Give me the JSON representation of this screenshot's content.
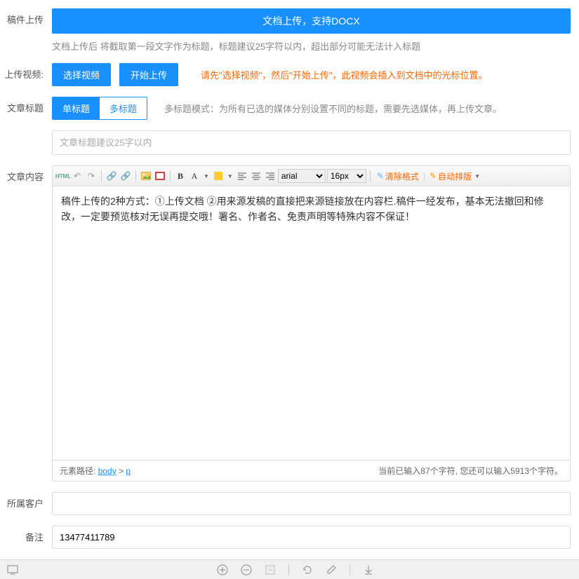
{
  "upload_doc": {
    "label": "稿件上传",
    "button": "文档上传，支持DOCX",
    "hint": "文档上传后 将截取第一段文字作为标题，标题建议25字符以内，超出部分可能无法计入标题"
  },
  "upload_video": {
    "label": "上传视频:",
    "select_btn": "选择视频",
    "start_btn": "开始上传",
    "hint": "请先\"选择视频\"，然后\"开始上传\"，此视频会插入到文档中的光标位置。"
  },
  "title": {
    "label": "文章标题",
    "tab_single": "单标题",
    "tab_multi": "多标题",
    "tab_hint": "多标题模式：为所有已选的媒体分别设置不同的标题，需要先选媒体，再上传文章。",
    "placeholder": "文章标题建议25字以内"
  },
  "content": {
    "label": "文章内容",
    "font_family": "arial",
    "font_size": "16px",
    "clear_format": "清除格式",
    "auto_typeset": "自动排版",
    "body_text": "稿件上传的2种方式：①上传文档 ②用来源发稿的直接把来源链接放在内容栏.稿件一经发布，基本无法撤回和修改，一定要预览核对无误再提交哦！署名、作者名、免责声明等特殊内容不保证！",
    "path_label": "元素路径:",
    "path_body": "body",
    "path_sep": ">",
    "path_p": "p",
    "count_text": "当前已输入87个字符, 您还可以输入5913个字符。"
  },
  "customer": {
    "label": "所属客户",
    "value": ""
  },
  "remark": {
    "label": "备注",
    "value": "13477411789"
  }
}
